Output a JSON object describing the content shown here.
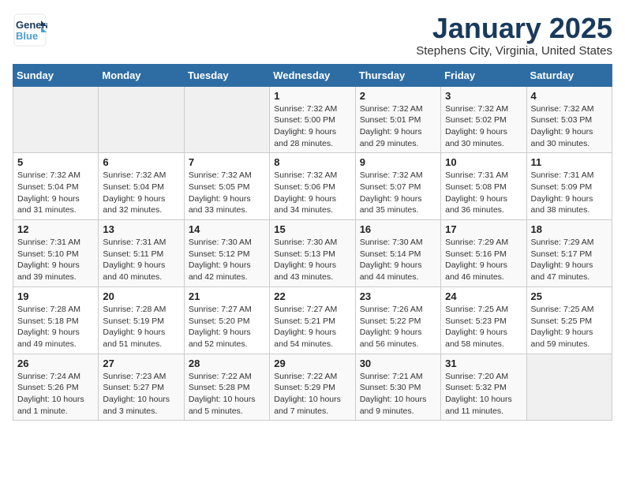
{
  "header": {
    "logo_general": "General",
    "logo_blue": "Blue",
    "title": "January 2025",
    "subtitle": "Stephens City, Virginia, United States"
  },
  "days_of_week": [
    "Sunday",
    "Monday",
    "Tuesday",
    "Wednesday",
    "Thursday",
    "Friday",
    "Saturday"
  ],
  "weeks": [
    [
      {
        "day": "",
        "info": ""
      },
      {
        "day": "",
        "info": ""
      },
      {
        "day": "",
        "info": ""
      },
      {
        "day": "1",
        "info": "Sunrise: 7:32 AM\nSunset: 5:00 PM\nDaylight: 9 hours\nand 28 minutes."
      },
      {
        "day": "2",
        "info": "Sunrise: 7:32 AM\nSunset: 5:01 PM\nDaylight: 9 hours\nand 29 minutes."
      },
      {
        "day": "3",
        "info": "Sunrise: 7:32 AM\nSunset: 5:02 PM\nDaylight: 9 hours\nand 30 minutes."
      },
      {
        "day": "4",
        "info": "Sunrise: 7:32 AM\nSunset: 5:03 PM\nDaylight: 9 hours\nand 30 minutes."
      }
    ],
    [
      {
        "day": "5",
        "info": "Sunrise: 7:32 AM\nSunset: 5:04 PM\nDaylight: 9 hours\nand 31 minutes."
      },
      {
        "day": "6",
        "info": "Sunrise: 7:32 AM\nSunset: 5:04 PM\nDaylight: 9 hours\nand 32 minutes."
      },
      {
        "day": "7",
        "info": "Sunrise: 7:32 AM\nSunset: 5:05 PM\nDaylight: 9 hours\nand 33 minutes."
      },
      {
        "day": "8",
        "info": "Sunrise: 7:32 AM\nSunset: 5:06 PM\nDaylight: 9 hours\nand 34 minutes."
      },
      {
        "day": "9",
        "info": "Sunrise: 7:32 AM\nSunset: 5:07 PM\nDaylight: 9 hours\nand 35 minutes."
      },
      {
        "day": "10",
        "info": "Sunrise: 7:31 AM\nSunset: 5:08 PM\nDaylight: 9 hours\nand 36 minutes."
      },
      {
        "day": "11",
        "info": "Sunrise: 7:31 AM\nSunset: 5:09 PM\nDaylight: 9 hours\nand 38 minutes."
      }
    ],
    [
      {
        "day": "12",
        "info": "Sunrise: 7:31 AM\nSunset: 5:10 PM\nDaylight: 9 hours\nand 39 minutes."
      },
      {
        "day": "13",
        "info": "Sunrise: 7:31 AM\nSunset: 5:11 PM\nDaylight: 9 hours\nand 40 minutes."
      },
      {
        "day": "14",
        "info": "Sunrise: 7:30 AM\nSunset: 5:12 PM\nDaylight: 9 hours\nand 42 minutes."
      },
      {
        "day": "15",
        "info": "Sunrise: 7:30 AM\nSunset: 5:13 PM\nDaylight: 9 hours\nand 43 minutes."
      },
      {
        "day": "16",
        "info": "Sunrise: 7:30 AM\nSunset: 5:14 PM\nDaylight: 9 hours\nand 44 minutes."
      },
      {
        "day": "17",
        "info": "Sunrise: 7:29 AM\nSunset: 5:16 PM\nDaylight: 9 hours\nand 46 minutes."
      },
      {
        "day": "18",
        "info": "Sunrise: 7:29 AM\nSunset: 5:17 PM\nDaylight: 9 hours\nand 47 minutes."
      }
    ],
    [
      {
        "day": "19",
        "info": "Sunrise: 7:28 AM\nSunset: 5:18 PM\nDaylight: 9 hours\nand 49 minutes."
      },
      {
        "day": "20",
        "info": "Sunrise: 7:28 AM\nSunset: 5:19 PM\nDaylight: 9 hours\nand 51 minutes."
      },
      {
        "day": "21",
        "info": "Sunrise: 7:27 AM\nSunset: 5:20 PM\nDaylight: 9 hours\nand 52 minutes."
      },
      {
        "day": "22",
        "info": "Sunrise: 7:27 AM\nSunset: 5:21 PM\nDaylight: 9 hours\nand 54 minutes."
      },
      {
        "day": "23",
        "info": "Sunrise: 7:26 AM\nSunset: 5:22 PM\nDaylight: 9 hours\nand 56 minutes."
      },
      {
        "day": "24",
        "info": "Sunrise: 7:25 AM\nSunset: 5:23 PM\nDaylight: 9 hours\nand 58 minutes."
      },
      {
        "day": "25",
        "info": "Sunrise: 7:25 AM\nSunset: 5:25 PM\nDaylight: 9 hours\nand 59 minutes."
      }
    ],
    [
      {
        "day": "26",
        "info": "Sunrise: 7:24 AM\nSunset: 5:26 PM\nDaylight: 10 hours\nand 1 minute."
      },
      {
        "day": "27",
        "info": "Sunrise: 7:23 AM\nSunset: 5:27 PM\nDaylight: 10 hours\nand 3 minutes."
      },
      {
        "day": "28",
        "info": "Sunrise: 7:22 AM\nSunset: 5:28 PM\nDaylight: 10 hours\nand 5 minutes."
      },
      {
        "day": "29",
        "info": "Sunrise: 7:22 AM\nSunset: 5:29 PM\nDaylight: 10 hours\nand 7 minutes."
      },
      {
        "day": "30",
        "info": "Sunrise: 7:21 AM\nSunset: 5:30 PM\nDaylight: 10 hours\nand 9 minutes."
      },
      {
        "day": "31",
        "info": "Sunrise: 7:20 AM\nSunset: 5:32 PM\nDaylight: 10 hours\nand 11 minutes."
      },
      {
        "day": "",
        "info": ""
      }
    ]
  ]
}
